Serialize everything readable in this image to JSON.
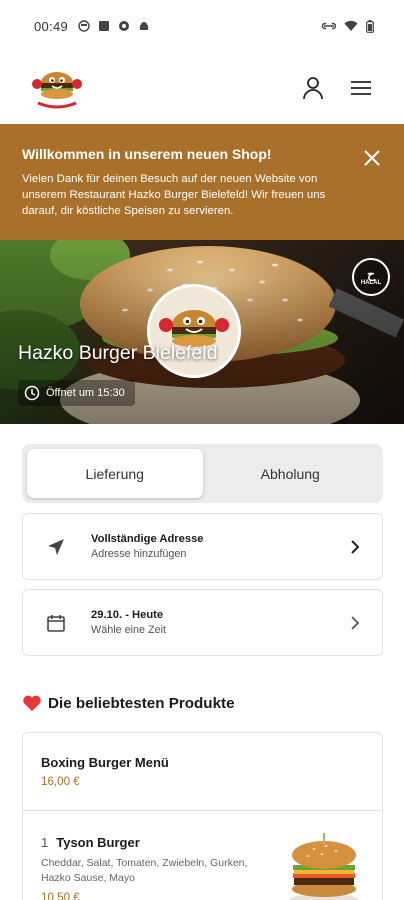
{
  "status_bar": {
    "time": "00:49"
  },
  "banner": {
    "title": "Willkommen in unserem neuen Shop!",
    "message": "Vielen Dank für deinen Besuch auf der neuen Website von unserem Restaurant Hazko Burger Bielefeld! Wir freuen uns darauf, dir köstliche Speisen zu servieren."
  },
  "hero": {
    "restaurant_name": "Hazko Burger Bielefeld",
    "opening_info": "Öffnet um 15:30",
    "halal_badge": "HALAL"
  },
  "order_mode": {
    "options": [
      "Lieferung",
      "Abholung"
    ],
    "selected": "Lieferung"
  },
  "address_card": {
    "title": "Vollständige Adresse",
    "subtitle": "Adresse hinzufügen"
  },
  "time_card": {
    "title": "29.10. - Heute",
    "subtitle": "Wähle eine Zeit"
  },
  "popular": {
    "heading": "Die beliebtesten Produkte",
    "products": [
      {
        "name": "Boxing Burger Menü",
        "price": "16,00 €"
      },
      {
        "quantity": "1",
        "name": "Tyson Burger",
        "description": "Cheddar, Salat, Tomaten, Zwiebeln, Gurken, Hazko Sause, Mayo",
        "price": "10,50 €"
      }
    ]
  },
  "colors": {
    "accent": "#a8702a",
    "heart": "#e53935"
  },
  "icons": [
    "user-icon",
    "menu-icon",
    "close-icon",
    "clock-icon",
    "navigation-arrow-icon",
    "calendar-icon",
    "chevron-right-icon",
    "heart-icon"
  ]
}
